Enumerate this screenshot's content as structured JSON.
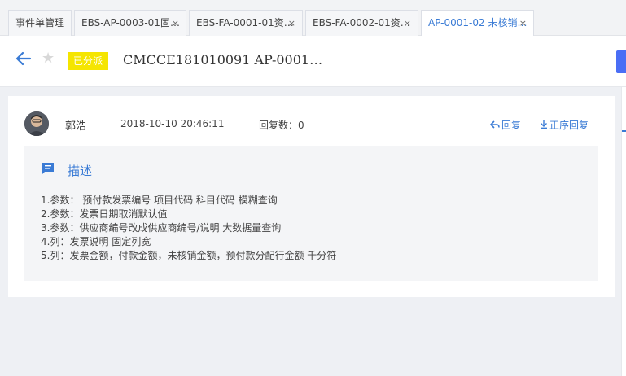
{
  "tabs": [
    {
      "label": "事件单管理",
      "closable": false,
      "active": false
    },
    {
      "label": "EBS-AP-0003-01固…",
      "closable": true,
      "active": false
    },
    {
      "label": "EBS-FA-0001-01资…",
      "closable": true,
      "active": false
    },
    {
      "label": "EBS-FA-0002-01资…",
      "closable": true,
      "active": false
    },
    {
      "label": "AP-0001-02 未核销…",
      "closable": true,
      "active": true
    }
  ],
  "tab_close_glyph": "×",
  "header": {
    "status_badge": "已分派",
    "title": "CMCCE181010091   AP-0001…",
    "back_icon": "arrow-left-icon",
    "star_icon": "star-icon"
  },
  "comment": {
    "author": "郭浩",
    "time": "2018-10-10 20:46:11",
    "reply_count_label": "回复数：0",
    "reply_label": "回复",
    "ordered_reply_label": "正序回复"
  },
  "description": {
    "title": "描述",
    "lines": [
      "1.参数：  预付款发票编号 项目代码 科目代码 模糊查询",
      "2.参数：发票日期取消默认值",
      "3.参数：供应商编号改成供应商编号/说明 大数据量查询",
      "4.列：发票说明 固定列宽",
      "5.列：发票金额，付款金额，未核销金额，预付款分配行金额 千分符"
    ]
  },
  "colors": {
    "accent": "#3a7bd5",
    "status_badge_bg": "#f5e500",
    "primary_button": "#4a6ef5"
  }
}
